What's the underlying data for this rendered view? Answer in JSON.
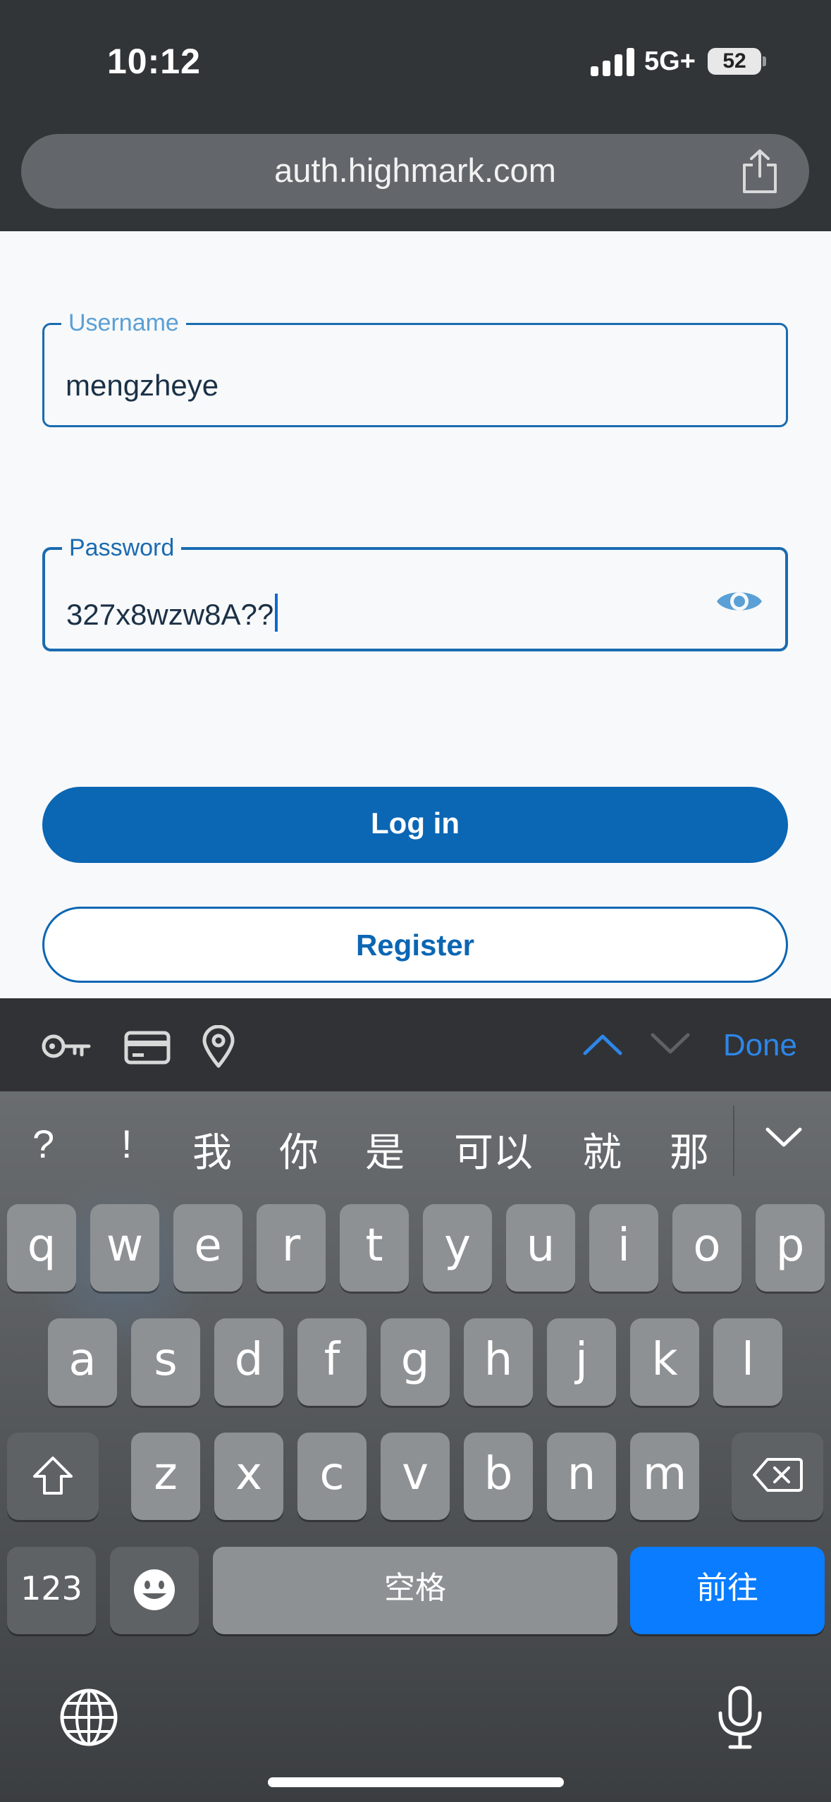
{
  "status_bar": {
    "time": "10:12",
    "network": "5G+",
    "battery": "52",
    "battery_level_percent": 52
  },
  "browser": {
    "url": "auth.highmark.com",
    "share_icon": "share-icon"
  },
  "form": {
    "username": {
      "label": "Username",
      "value": "mengzheye"
    },
    "password": {
      "label": "Password",
      "value": "327x8wzw8A??",
      "reveal_icon": "eye-icon"
    },
    "login_label": "Log in",
    "register_label": "Register"
  },
  "colors": {
    "brand_blue": "#0b66b4",
    "field_label": "#5aa0d6",
    "keyboard_go": "#0a7cff"
  },
  "accessory_bar": {
    "icons": [
      "key-icon",
      "credit-card-icon",
      "location-pin-icon"
    ],
    "prev_icon": "chevron-up-icon",
    "next_icon": "chevron-down-icon",
    "done_label": "Done"
  },
  "keyboard": {
    "candidates": [
      "?",
      "!",
      "我",
      "你",
      "是",
      "可以",
      "就",
      "那"
    ],
    "row1": [
      "q",
      "w",
      "e",
      "r",
      "t",
      "y",
      "u",
      "i",
      "o",
      "p"
    ],
    "row2": [
      "a",
      "s",
      "d",
      "f",
      "g",
      "h",
      "j",
      "k",
      "l"
    ],
    "row3": [
      "z",
      "x",
      "c",
      "v",
      "b",
      "n",
      "m"
    ],
    "numbers_label": "123",
    "space_label": "空格",
    "go_label": "前往",
    "shift_icon": "shift-icon",
    "delete_icon": "delete-icon",
    "emoji_icon": "emoji-icon",
    "globe_icon": "globe-icon",
    "mic_icon": "microphone-icon"
  }
}
